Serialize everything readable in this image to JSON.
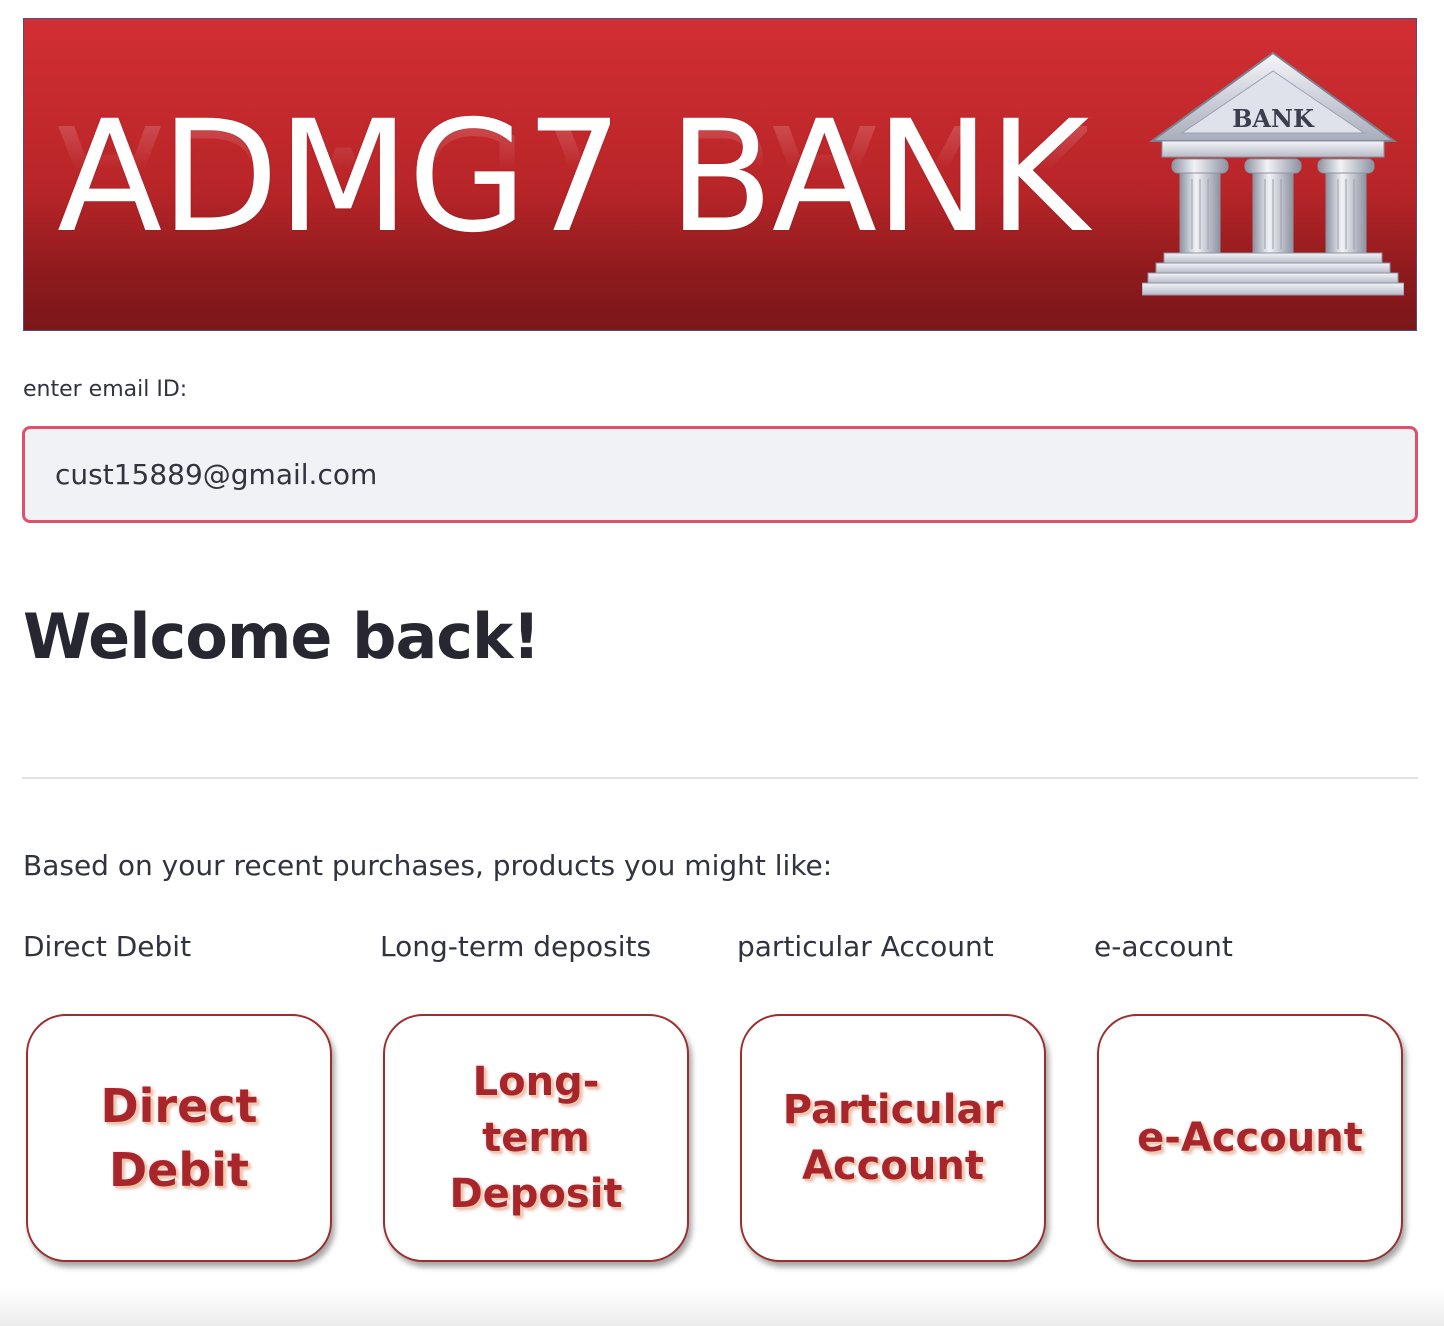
{
  "banner": {
    "title": "ADMG7 BANK",
    "logo_text": "BANK",
    "colors": {
      "banner_red": "#d22f33",
      "banner_dark_red": "#7a1719"
    }
  },
  "email": {
    "label": "enter email ID:",
    "value": "cust15889@gmail.com",
    "border_color": "#e0506a"
  },
  "welcome": {
    "heading": "Welcome back!"
  },
  "recommendations": {
    "intro": "Based on your recent purchases, products you might like:",
    "products": [
      {
        "name": "Direct Debit",
        "card_text": "Direct\nDebit"
      },
      {
        "name": "Long-term deposits",
        "card_text": "Long-\nterm\nDeposit"
      },
      {
        "name": "particular Account",
        "card_text": "Particular\nAccount"
      },
      {
        "name": "e-account",
        "card_text": "e-Account"
      }
    ],
    "card_text_color": "#a8262b"
  }
}
